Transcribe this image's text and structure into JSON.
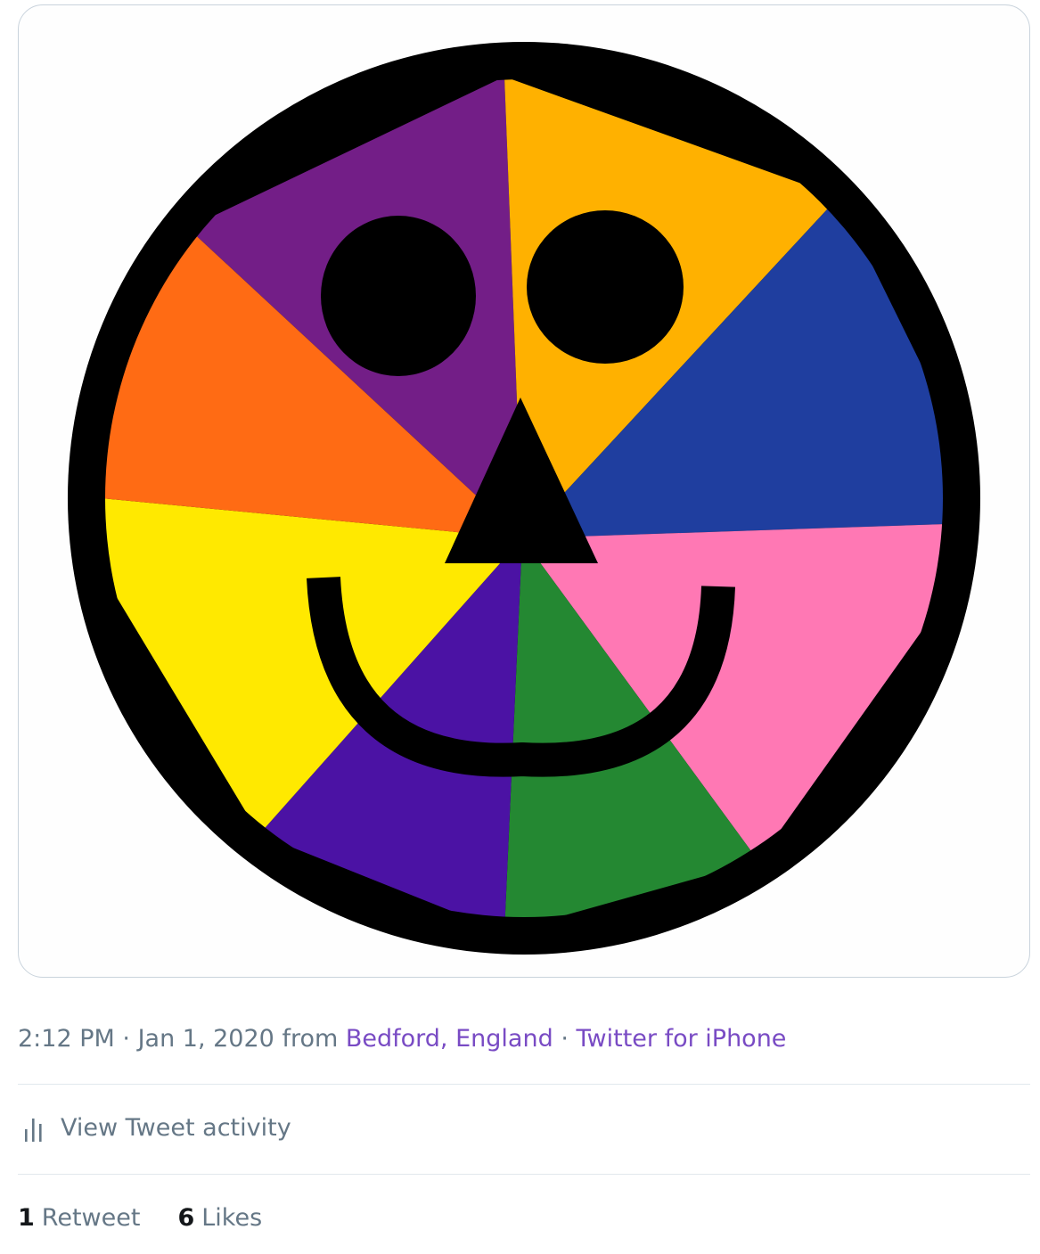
{
  "tweet": {
    "time": "2:12 PM",
    "date": "Jan 1, 2020",
    "from_label": "from",
    "location": "Bedford, England",
    "source": "Twitter for iPhone",
    "separator": "·"
  },
  "activity": {
    "label": "View Tweet activity",
    "icon": "bar-chart-icon"
  },
  "stats": {
    "retweets_count": "1",
    "retweets_label": "Retweet",
    "likes_count": "6",
    "likes_label": "Likes"
  },
  "image": {
    "subject": "rainbow-smiley-face",
    "colors": {
      "purple": "#731e87",
      "amber": "#ffb100",
      "blue": "#1f3e9f",
      "pink": "#ff78b4",
      "green": "#248832",
      "violet": "#4b12a4",
      "yellow": "#ffe900",
      "orange": "#ff6b14",
      "outline": "#000000"
    }
  },
  "colors": {
    "link": "#794bc4",
    "muted": "#657786",
    "strong": "#14171a",
    "divider": "#e1e8ed"
  }
}
